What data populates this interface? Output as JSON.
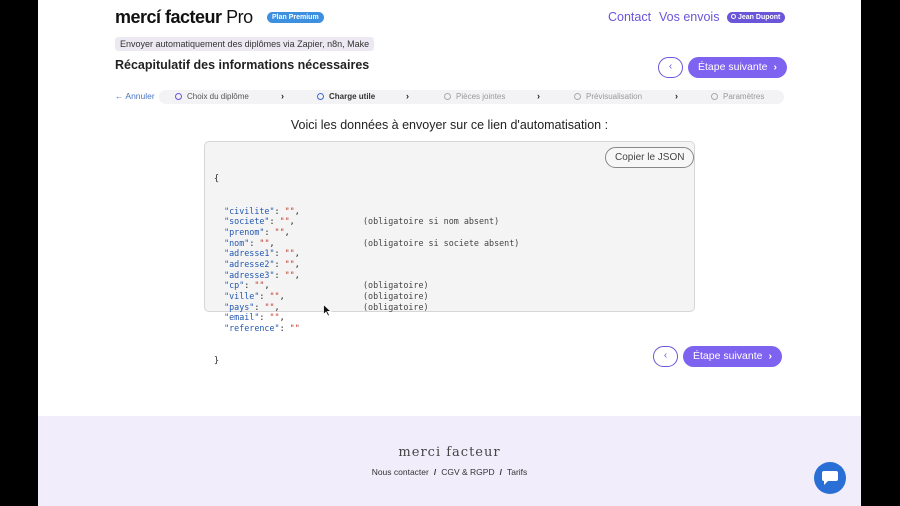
{
  "header": {
    "brand_main": "mercí facteur",
    "brand_pro": "Pro",
    "plan_badge": "Plan Premium",
    "nav": [
      {
        "label": "Contact"
      },
      {
        "label": "Vos envois"
      }
    ],
    "user_badge": "Jean Dupont"
  },
  "subheader": {
    "chip": "Envoyer automatiquement des diplômes via Zapier, n8n, Make",
    "title": "Récapitulatif des informations nécessaires"
  },
  "buttons": {
    "back_icon": "‹",
    "next_label": "Étape suivante",
    "next_icon": "›"
  },
  "stepper": {
    "cancel": "Annuler",
    "separator": "›",
    "steps": [
      {
        "label": "Choix du diplôme",
        "state": "done"
      },
      {
        "label": "Charge utile",
        "state": "active"
      },
      {
        "label": "Pièces jointes",
        "state": "todo"
      },
      {
        "label": "Prévisualisation",
        "state": "todo"
      },
      {
        "label": "Paramètres",
        "state": "todo"
      }
    ]
  },
  "main": {
    "intro": "Voici les données à envoyer sur ce lien d'automatisation :",
    "copy_button": "Copier le JSON",
    "json_open": "{",
    "json_close": "}",
    "json_fields": [
      {
        "key": "\"civilite\"",
        "value": "\"\"",
        "tail": ",",
        "note": ""
      },
      {
        "key": "\"societe\"",
        "value": "\"\"",
        "tail": ",",
        "note": "(obligatoire si nom absent)"
      },
      {
        "key": "\"prenom\"",
        "value": "\"\"",
        "tail": ",",
        "note": ""
      },
      {
        "key": "\"nom\"",
        "value": "\"\"",
        "tail": ",",
        "note": "(obligatoire si societe absent)"
      },
      {
        "key": "\"adresse1\"",
        "value": "\"\"",
        "tail": ",",
        "note": ""
      },
      {
        "key": "\"adresse2\"",
        "value": "\"\"",
        "tail": ",",
        "note": ""
      },
      {
        "key": "\"adresse3\"",
        "value": "\"\"",
        "tail": ",",
        "note": ""
      },
      {
        "key": "\"cp\"",
        "value": "\"\"",
        "tail": ",",
        "note": "(obligatoire)"
      },
      {
        "key": "\"ville\"",
        "value": "\"\"",
        "tail": ",",
        "note": "(obligatoire)"
      },
      {
        "key": "\"pays\"",
        "value": "\"\"",
        "tail": ",",
        "note": "(obligatoire)"
      },
      {
        "key": "\"email\"",
        "value": "\"\"",
        "tail": ",",
        "note": ""
      },
      {
        "key": "\"reference\"",
        "value": "\"\"",
        "tail": "",
        "note": ""
      }
    ]
  },
  "footer": {
    "logo": "merci facteur",
    "links": [
      "Nous contacter",
      "CGV & RGPD",
      "Tarifs"
    ],
    "separator": "/"
  },
  "colors": {
    "accent": "#7d63f0",
    "link": "#6b55d9",
    "plan_badge": "#3d8fe0",
    "footer_bg": "#f1edfb",
    "chat": "#2a6fd6"
  },
  "icons": {
    "back": "chevron-left-icon",
    "next": "chevron-right-icon",
    "cancel": "arrow-left-icon",
    "step_done": "check-circle-icon",
    "step_todo": "circle-icon",
    "chat": "chat-bubble-icon"
  }
}
